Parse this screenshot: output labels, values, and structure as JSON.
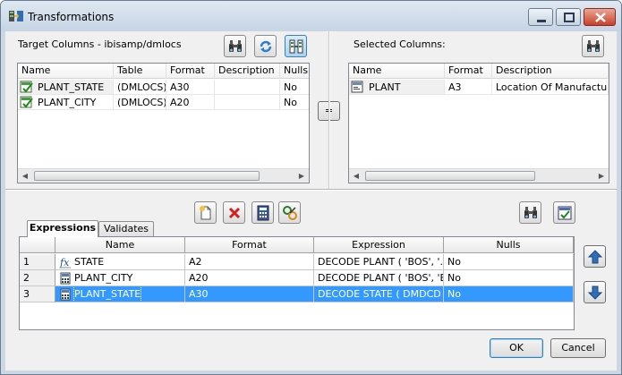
{
  "window": {
    "title": "Transformations"
  },
  "target_panel": {
    "title": "Target Columns - ibisamp/dmlocs",
    "columns": [
      "Name",
      "Table",
      "Format",
      "Description",
      "Nulls"
    ],
    "rows": [
      {
        "name": "PLANT_STATE",
        "table": "(DMLOCS)",
        "format": "A30",
        "description": "",
        "nulls": "No"
      },
      {
        "name": "PLANT_CITY",
        "table": "(DMLOCS)",
        "format": "A20",
        "description": "",
        "nulls": "No"
      }
    ]
  },
  "equals_button": {
    "label": "="
  },
  "selected_panel": {
    "title": "Selected Columns:",
    "columns": [
      "Name",
      "Format",
      "Description"
    ],
    "rows": [
      {
        "name": "PLANT",
        "format": "A3",
        "description": "Location Of Manufacturing"
      }
    ]
  },
  "tabs": [
    {
      "label": "Expressions"
    },
    {
      "label": "Validates"
    }
  ],
  "expressions_grid": {
    "columns": [
      "",
      "Name",
      "Format",
      "Expression",
      "Nulls"
    ],
    "rows": [
      {
        "num": "1",
        "icon": "function-icon",
        "name": "STATE",
        "format": "A2",
        "expression": "DECODE PLANT ( 'BOS', '...",
        "nulls": "No"
      },
      {
        "num": "2",
        "icon": "calculator-icon",
        "name": "PLANT_CITY",
        "format": "A20",
        "expression": "DECODE PLANT ( 'BOS', 'B...",
        "nulls": "No"
      },
      {
        "num": "3",
        "icon": "calculator-icon",
        "name": "PLANT_STATE",
        "format": "A30",
        "expression": "DECODE STATE ( DMDCD )",
        "nulls": "No",
        "selected": true
      }
    ]
  },
  "footer": {
    "ok_label": "OK",
    "cancel_label": "Cancel"
  },
  "colors": {
    "selection": "#3399ff",
    "client_bg": "#f0f0f0",
    "title_bg": "#cdd7e3"
  }
}
